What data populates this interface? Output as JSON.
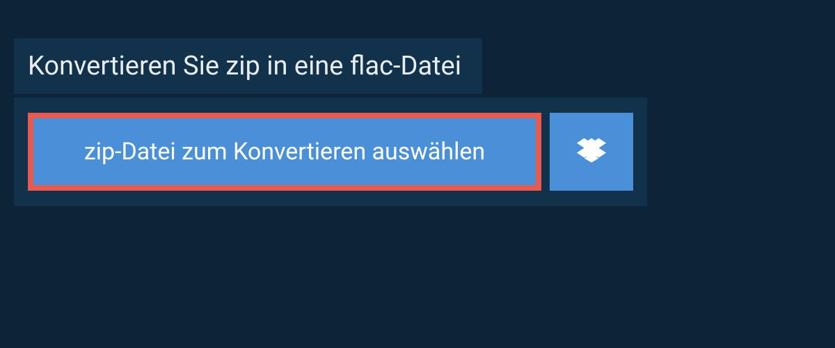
{
  "header": {
    "title": "Konvertieren Sie zip in eine flac-Datei"
  },
  "actions": {
    "select_file_label": "zip-Datei zum Konvertieren auswählen",
    "dropbox_icon": "dropbox"
  },
  "colors": {
    "page_bg": "#0d2438",
    "panel_bg": "#12324b",
    "button_bg": "#4a90d9",
    "highlight_border": "#e85a4f",
    "text": "#e8edf2"
  }
}
